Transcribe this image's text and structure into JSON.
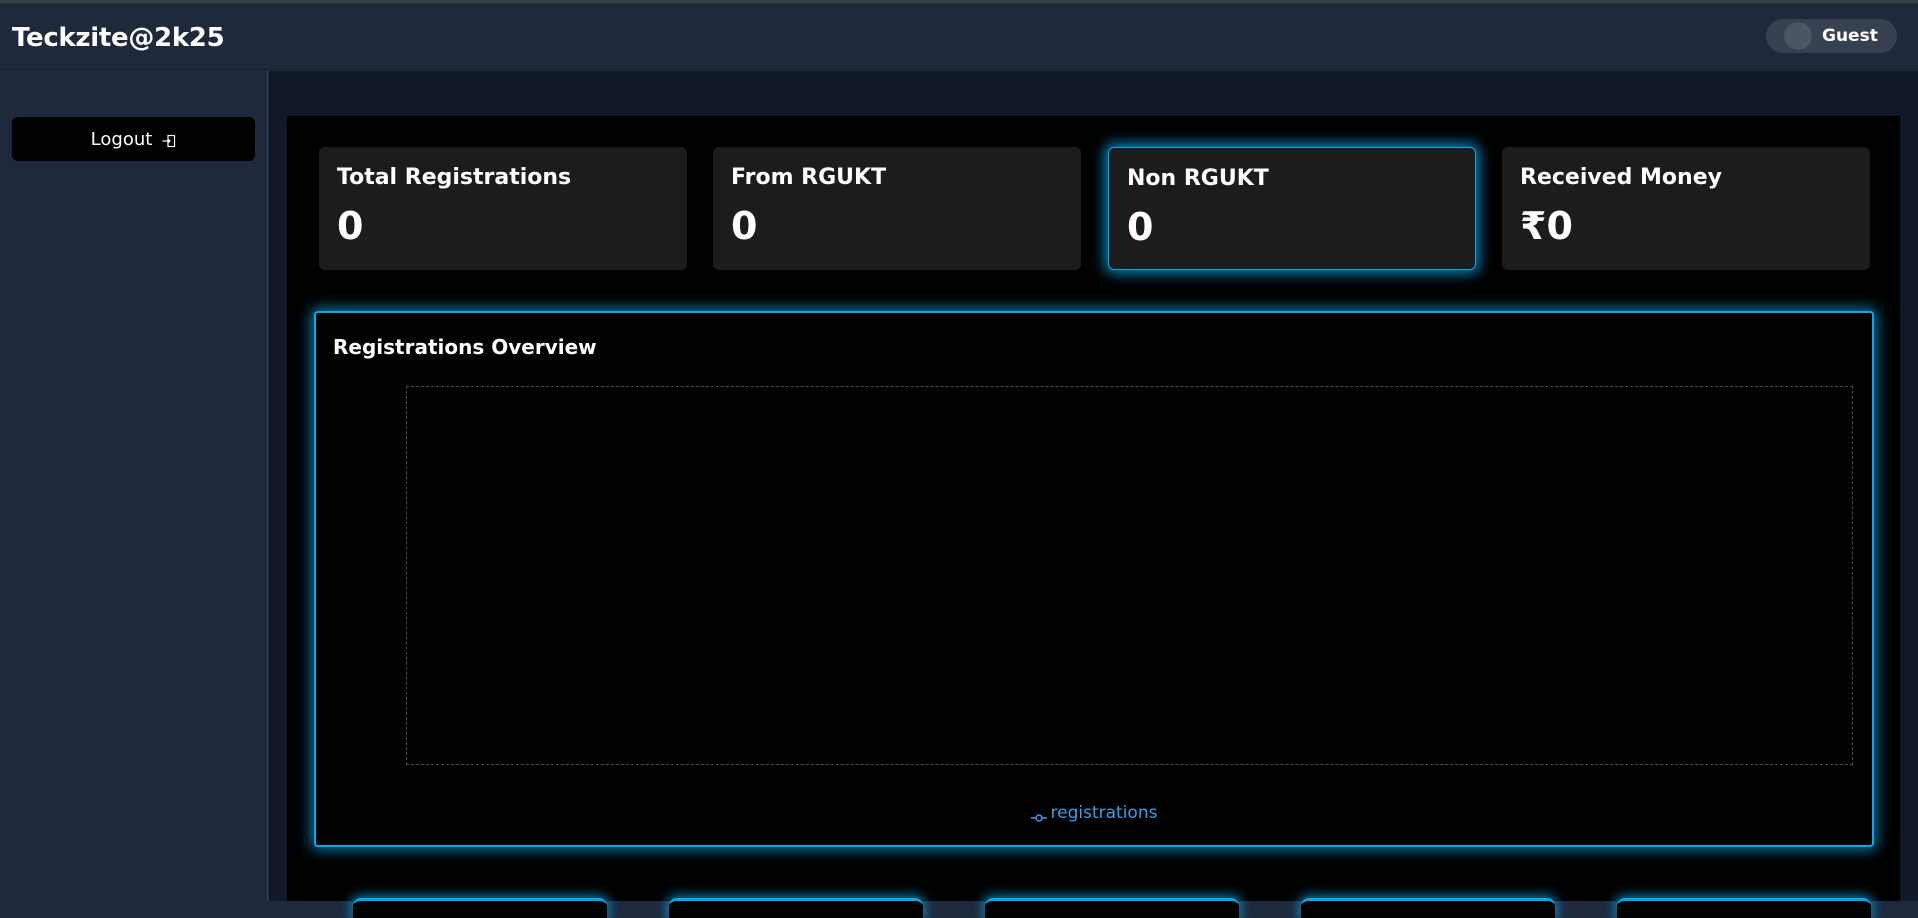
{
  "header": {
    "brand": "Teckzite@2k25",
    "user_name": "Guest"
  },
  "sidebar": {
    "logout_label": "Logout"
  },
  "stats": [
    {
      "title": "Total Registrations",
      "value": "0"
    },
    {
      "title": "From RGUKT",
      "value": "0"
    },
    {
      "title": "Non RGUKT",
      "value": "0"
    },
    {
      "title": "Received Money",
      "value": "₹0"
    }
  ],
  "overview": {
    "title": "Registrations Overview",
    "legend_label": "registrations"
  },
  "colors": {
    "accent": "#0ea5e9",
    "legend": "#3b9ee8",
    "card_bg": "#1c1c1c",
    "panel_bg": "#000000",
    "sidebar_bg": "#1e293b"
  },
  "chart_data": {
    "type": "line",
    "series": [
      {
        "name": "registrations",
        "values": []
      }
    ]
  }
}
